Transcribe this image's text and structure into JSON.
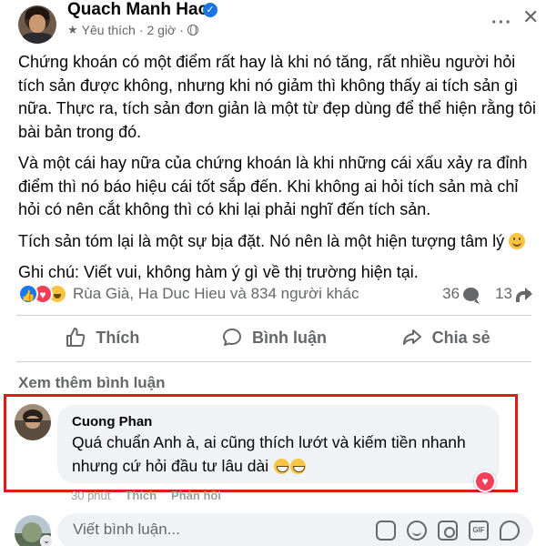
{
  "post": {
    "author": "Quach Manh Hao",
    "meta_favorite": "Yêu thích",
    "meta_separator": "·",
    "meta_time": "2 giờ",
    "meta_dot": "·",
    "paragraphs": [
      "Chứng khoán có một điểm rất hay là khi nó tăng, rất nhiều người hỏi tích sản được không, nhưng khi nó giảm thì không thấy ai tích sản gì nữa. Thực ra, tích sản đơn giản là một từ đẹp dùng để thể hiện rằng tôi bài bản trong đó.",
      "Và một cái hay nữa của chứng khoán là khi những cái xấu xảy ra đỉnh điểm thì nó báo hiệu cái tốt sắp đến. Khi không ai hỏi tích sản mà chỉ hỏi có nên cắt không thì có khi lại phải nghĩ đến tích sản.",
      "Tích sản tóm lại là một sự bịa đặt. Nó nên là một hiện tượng tâm lý",
      "Ghi chú: Viết vui, không hàm ý gì về thị trường hiện tại."
    ]
  },
  "reactions": {
    "names": "Rùa Già, Ha Duc Hieu và 834 người khác",
    "comment_count": "36",
    "share_count": "13"
  },
  "actions": {
    "like": "Thích",
    "comment": "Bình luận",
    "share": "Chia sẻ"
  },
  "comments": {
    "see_more": "Xem thêm bình luận",
    "highlighted": {
      "author": "Cuong Phan",
      "text": "Quá chuẩn Anh à, ai cũng thích lướt và kiếm tiền nhanh nhưng cứ hỏi đầu tư lâu dài",
      "time": "30 phút",
      "like": "Thích",
      "reply": "Phản hồi"
    }
  },
  "composer": {
    "placeholder": "Viết bình luận..."
  },
  "colors": {
    "accent": "#1877f2",
    "highlight_border": "#e01919",
    "secondary_text": "#65676b",
    "bubble_bg": "#f0f2f5"
  }
}
